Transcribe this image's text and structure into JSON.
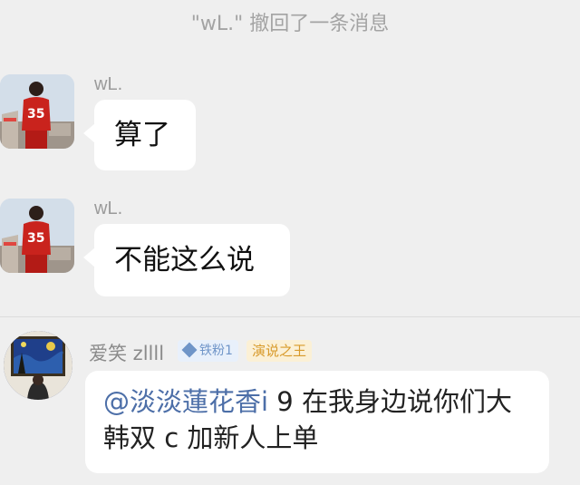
{
  "notice": "\"wL.\" 撤回了一条消息",
  "messages": [
    {
      "sender": "wL.",
      "text": "算了",
      "avatar_jersey": "35"
    },
    {
      "sender": "wL.",
      "text": "不能这么说",
      "avatar_jersey": "35"
    }
  ],
  "comment": {
    "username": "爱笑 zllll",
    "fan_badge": "铁粉1",
    "title_badge": "演说之王",
    "mention": "@淡淡蓮花香i",
    "text": " 9 在我身边说你们大韩双 c 加新人上单"
  },
  "colors": {
    "background": "#efefef",
    "bubble": "#ffffff",
    "mention": "#4d6fa8",
    "fan_badge": "#6f95c8",
    "title_badge": "#d89a2b"
  }
}
